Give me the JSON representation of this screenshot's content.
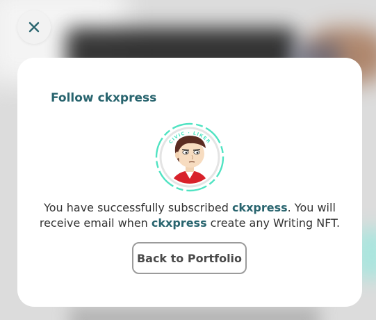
{
  "dialog": {
    "title_prefix": "Follow",
    "author": "ckxpress",
    "badge_text": "CIVIC · LIKER",
    "message": {
      "part1": "You have successfully subscribed ",
      "author1": "ckxpress",
      "part2": ". You will receive email when ",
      "author2": "ckxpress",
      "part3": " create any Writing NFT."
    },
    "back_button_label": "Back to Portfolio"
  },
  "close_button": {
    "icon": "close-icon"
  },
  "colors": {
    "accent": "#28646e",
    "civic_ring": "#50e3c2",
    "button_border": "#9b9b9b",
    "backdrop": "#dcdcdc"
  }
}
